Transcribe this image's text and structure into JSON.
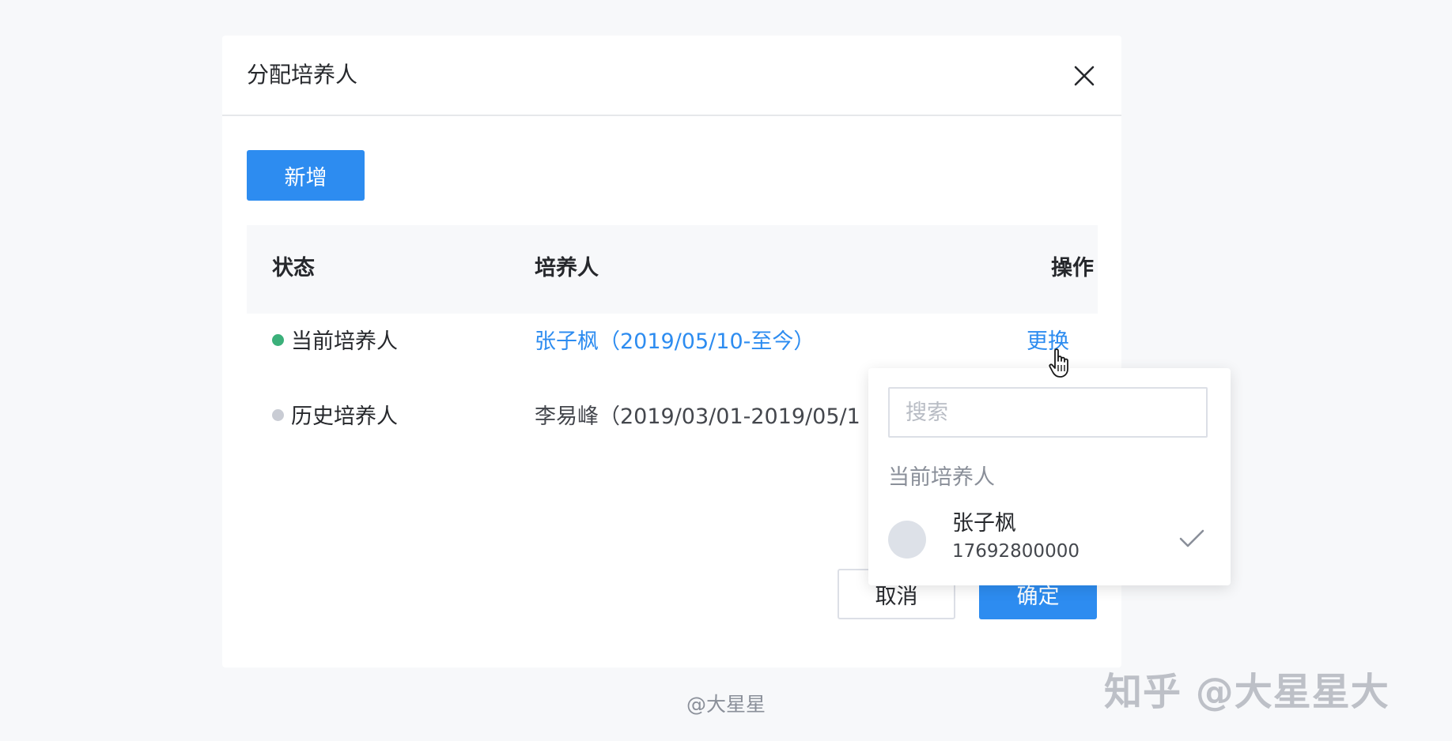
{
  "modal": {
    "title": "分配培养人",
    "add_label": "新增"
  },
  "table": {
    "headers": {
      "status": "状态",
      "trainer": "培养人",
      "action": "操作"
    },
    "rows": [
      {
        "status": "当前培养人",
        "status_color": "#3bb07a",
        "trainer": "张子枫（2019/05/10-至今）",
        "action": "更换"
      },
      {
        "status": "历史培养人",
        "status_color": "#c9ccd4",
        "trainer": "李易峰（2019/03/01-2019/05/1"
      }
    ]
  },
  "footer": {
    "cancel_label": "取消",
    "confirm_label": "确定"
  },
  "dropdown": {
    "search_placeholder": "搜索",
    "group_label": "当前培养人",
    "option": {
      "name": "张子枫",
      "phone": "17692800000",
      "selected": true
    }
  },
  "caption": "@大星星",
  "watermark": "知乎 @大星星大",
  "colors": {
    "primary": "#2d8cf0",
    "current_dot": "#3bb07a",
    "history_dot": "#c9ccd4"
  }
}
